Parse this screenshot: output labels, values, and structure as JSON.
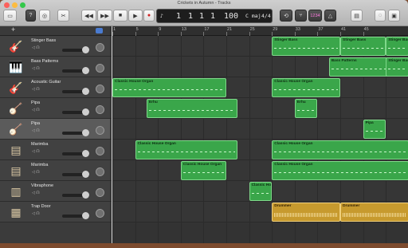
{
  "window": {
    "title": "Crickets in Autumn - Tracks"
  },
  "lcd": {
    "bar": "1",
    "beat": "1",
    "div": "1",
    "tick": "1",
    "tempo": "100",
    "key": "C maj",
    "signature": "4/4"
  },
  "toolbar": {
    "count_in": "1234"
  },
  "ruler": [
    "1",
    "5",
    "9",
    "13",
    "17",
    "21",
    "25",
    "29",
    "33",
    "37",
    "41",
    "45"
  ],
  "tracks": [
    {
      "name": "Stinger Bass",
      "icon": "bass-guitar-icon",
      "glyph": "🎸"
    },
    {
      "name": "Bass Patterns",
      "icon": "keyboard-icon",
      "glyph": "🎹"
    },
    {
      "name": "Acoustic Guitar",
      "icon": "acoustic-guitar-icon",
      "glyph": "🎸"
    },
    {
      "name": "Pipa",
      "icon": "pipa-icon",
      "glyph": "🪕"
    },
    {
      "name": "Pipa",
      "icon": "pipa-icon",
      "glyph": "🪕"
    },
    {
      "name": "Marimba",
      "icon": "marimba-icon",
      "glyph": "▤"
    },
    {
      "name": "Marimba",
      "icon": "marimba-icon",
      "glyph": "▤"
    },
    {
      "name": "Vibraphone",
      "icon": "vibraphone-icon",
      "glyph": "▥"
    },
    {
      "name": "Trap Door",
      "icon": "drum-machine-icon",
      "glyph": "▦"
    }
  ],
  "regions": [
    {
      "track": 0,
      "start": 29,
      "end": 41,
      "label": "Stinger Bass",
      "color": "green"
    },
    {
      "track": 0,
      "start": 41,
      "end": 49,
      "label": "Stinger Bass",
      "color": "green"
    },
    {
      "track": 0,
      "start": 49,
      "end": 53,
      "label": "Stinger Bass",
      "color": "green"
    },
    {
      "track": 1,
      "start": 39,
      "end": 50,
      "label": "Bass Patterns",
      "color": "green"
    },
    {
      "track": 1,
      "start": 49,
      "end": 53,
      "label": "Stinger Bass",
      "color": "green"
    },
    {
      "track": 2,
      "start": 1,
      "end": 21,
      "label": "Classic House Organ",
      "color": "green"
    },
    {
      "track": 2,
      "start": 29,
      "end": 41,
      "label": "Classic House Organ",
      "color": "green"
    },
    {
      "track": 3,
      "start": 7,
      "end": 23,
      "label": "Erhu",
      "color": "green"
    },
    {
      "track": 3,
      "start": 33,
      "end": 37,
      "label": "Erhu",
      "color": "green"
    },
    {
      "track": 4,
      "start": 45,
      "end": 49,
      "label": "Pipa",
      "color": "green"
    },
    {
      "track": 5,
      "start": 5,
      "end": 23,
      "label": "Classic House Organ",
      "color": "green"
    },
    {
      "track": 5,
      "start": 29,
      "end": 53,
      "label": "Classic House Organ",
      "color": "green"
    },
    {
      "track": 6,
      "start": 13,
      "end": 21,
      "label": "Classic House Organ",
      "color": "green"
    },
    {
      "track": 6,
      "start": 29,
      "end": 53,
      "label": "Classic House Organ",
      "color": "green"
    },
    {
      "track": 7,
      "start": 25,
      "end": 29,
      "label": "Classic House Organ",
      "color": "green"
    },
    {
      "track": 8,
      "start": 29,
      "end": 41,
      "label": "Drummer",
      "color": "gold"
    },
    {
      "track": 8,
      "start": 41,
      "end": 53,
      "label": "Drummer",
      "color": "gold"
    }
  ]
}
